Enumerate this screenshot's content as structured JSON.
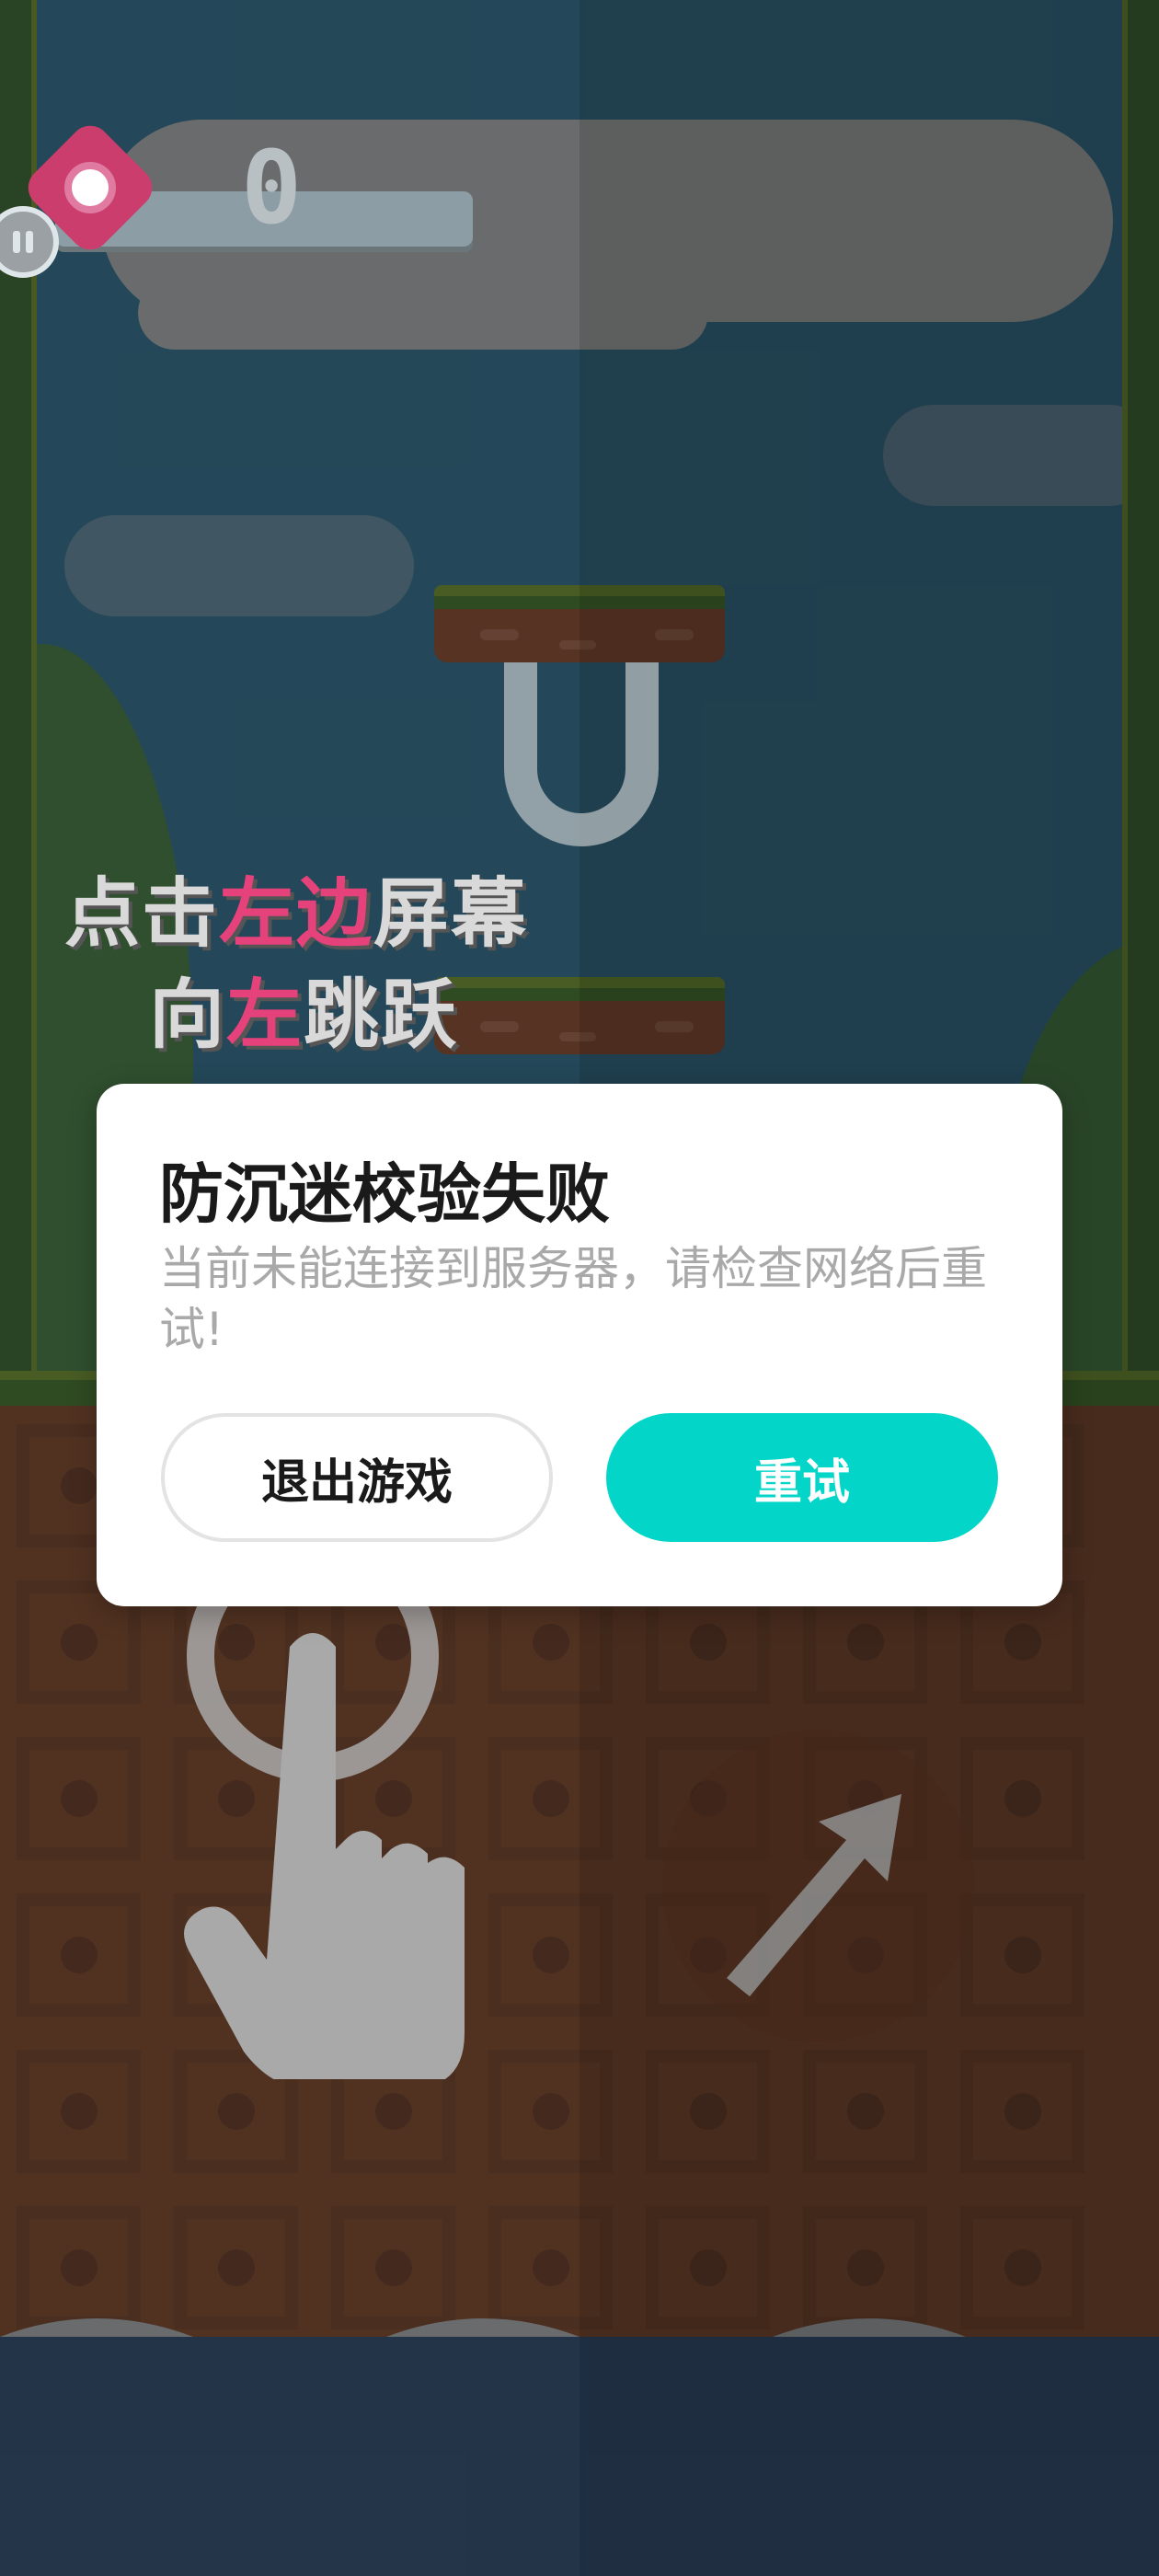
{
  "hud": {
    "score": "0",
    "pause_icon": "pause-icon",
    "coin_icon": "gem-icon"
  },
  "hint": {
    "line1_a": "点击",
    "line1_b": "左边",
    "line1_c": "屏幕",
    "line2_a": "向",
    "line2_b": "左",
    "line2_c": "跳跃"
  },
  "dialog": {
    "title": "防沉迷校验失败",
    "message": "当前未能连接到服务器，请检查网络后重试!",
    "exit_label": "退出游戏",
    "retry_label": "重试"
  },
  "colors": {
    "retry_button": "#03d6c8",
    "hint_highlight": "#e5417a",
    "sky": "#1f87b8",
    "ground": "#a24715"
  }
}
